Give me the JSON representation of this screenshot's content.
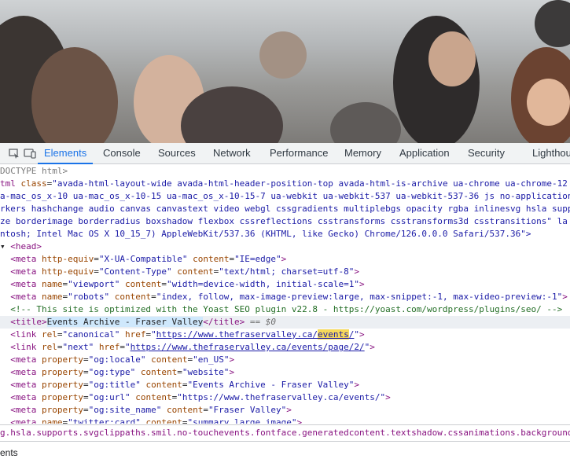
{
  "devtools": {
    "tabs": [
      "Elements",
      "Console",
      "Sources",
      "Network",
      "Performance",
      "Memory",
      "Application",
      "Security",
      "Lighthou"
    ],
    "active_tab": "Elements",
    "code": {
      "l0": "DOCTYPE html>",
      "l1_tag": "tml",
      "l1_attr": "class",
      "l1_val": "\"avada-html-layout-wide avada-html-header-position-top avada-html-is-archive ua-chrome ua-chrome-12",
      "l2": "a-mac_os_x-10 ua-mac_os_x-10-15 ua-mac_os_x-10-15-7 ua-webkit ua-webkit-537 ua-webkit-537-36 js no-application",
      "l3": "rkers hashchange audio canvas canvastext video webgl cssgradients multiplebgs opacity rgba inlinesvg hsla supp",
      "l4": "ze borderimage borderradius boxshadow flexbox cssreflections csstransforms csstransforms3d csstransitions\" la",
      "l5": "ntosh; Intel Mac OS X 10_15_7) AppleWebKit/537.36 (KHTML, like Gecko) Chrome/126.0.0.0 Safari/537.36\">",
      "head": "head",
      "meta1_val1": "\"X-UA-Compatible\"",
      "meta1_val2": "\"IE=edge\"",
      "meta2_val1": "\"Content-Type\"",
      "meta2_val2": "\"text/html; charset=utf-8\"",
      "meta3_val1": "\"viewport\"",
      "meta3_val2": "\"width=device-width, initial-scale=1\"",
      "meta4_val1": "\"robots\"",
      "meta4_val2": "\"index, follow, max-image-preview:large, max-snippet:-1, max-video-preview:-1\"",
      "comment": "<!-- This site is optimized with the Yoast SEO plugin v22.8 - https://yoast.com/wordpress/plugins/seo/ -->",
      "title_text": "Events Archive - Fraser Valley",
      "eq0": "== $0",
      "canon_rel": "\"canonical\"",
      "canon_href_pre": "https://www.thefraservalley.ca/",
      "canon_href_hl": "events",
      "canon_href_post": "/",
      "next_rel": "\"next\"",
      "next_href": "https://www.thefraservalley.ca/events/page/2/",
      "og_locale": "\"og:locale\"",
      "og_locale_v": "\"en_US\"",
      "og_type": "\"og:type\"",
      "og_type_v": "\"website\"",
      "og_title": "\"og:title\"",
      "og_title_v": "\"Events Archive - Fraser Valley\"",
      "og_url": "\"og:url\"",
      "og_url_v": "\"https://www.thefraservalley.ca/events/\"",
      "og_site": "\"og:site_name\"",
      "og_site_v": "\"Fraser Valley\"",
      "tw_card": "\"twitter:card\"",
      "tw_card_v": "\"summary_large_image\""
    },
    "breadcrumb": "g.hsla.supports.svgclippaths.smil.no-touchevents.fontface.generatedcontent.textshadow.cssanimations.backgroundsize.borderi",
    "bottom_label": "ents"
  },
  "colors": {
    "active_tab": "#1a73e8",
    "tag": "#881280",
    "attr": "#994500",
    "value": "#1a1aa6",
    "comment": "#236e25",
    "search_highlight": "#f6d95b"
  }
}
